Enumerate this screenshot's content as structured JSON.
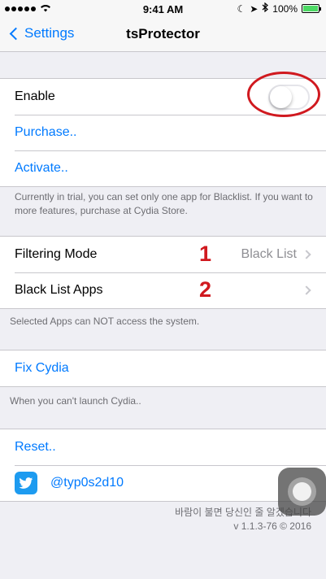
{
  "status_bar": {
    "time": "9:41 AM",
    "battery": "100%",
    "battery_level": 1.0,
    "icons": [
      "signal-dots-icon",
      "wifi-icon",
      "moon-icon",
      "location-arrow-icon",
      "bluetooth-icon",
      "battery-icon"
    ]
  },
  "nav": {
    "back_label": "Settings",
    "title": "tsProtector"
  },
  "section1": {
    "enable_label": "Enable",
    "enable_on": false,
    "purchase_label": "Purchase..",
    "activate_label": "Activate..",
    "footer": "Currently in trial, you can set only one app for Blacklist. If you want to more features, purchase at Cydia Store."
  },
  "section2": {
    "filtering_mode_label": "Filtering Mode",
    "filtering_mode_value": "Black List",
    "filtering_mode_marker": "1",
    "black_list_apps_label": "Black List Apps",
    "black_list_apps_marker": "2",
    "footer": "Selected Apps can NOT access the system."
  },
  "section3": {
    "fix_cydia_label": "Fix Cydia",
    "footer": "When you can't launch Cydia.."
  },
  "section4": {
    "reset_label": "Reset..",
    "twitter_handle": "@typ0s2d10"
  },
  "credit": {
    "korean_line": "바람이 불면 당신인 줄 알겠습니다",
    "version": "v 1.1.3-76 © 2016"
  },
  "colors": {
    "accent": "#007aff",
    "annotation_red": "#d0191f",
    "background": "#efeff4",
    "twitter_blue": "#1d9bf0",
    "toggle_on_green": "#4cd964"
  }
}
